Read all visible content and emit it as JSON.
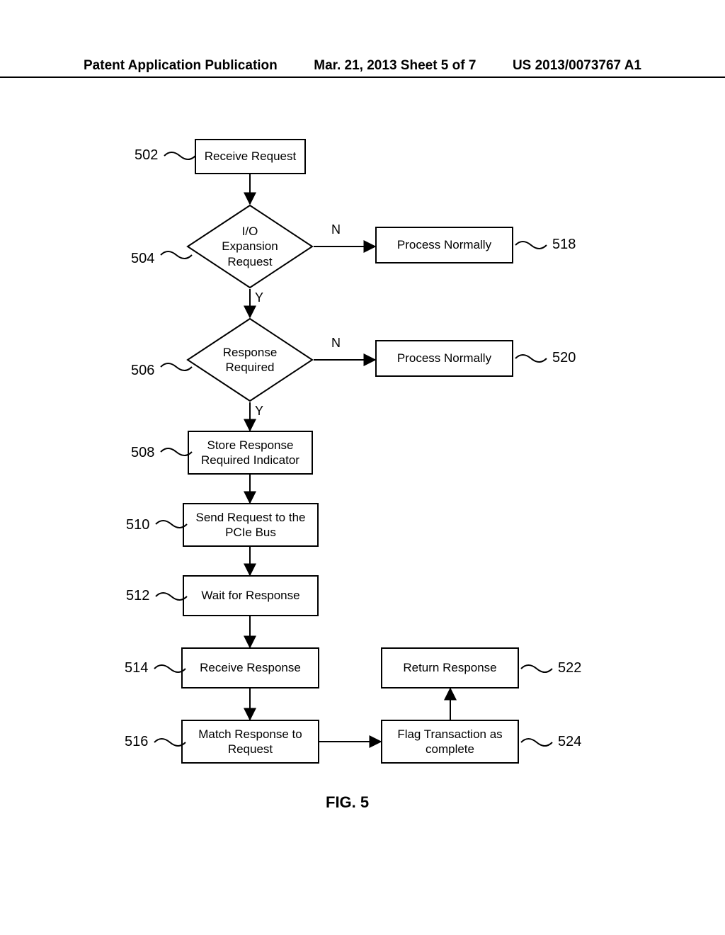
{
  "header": {
    "left": "Patent Application Publication",
    "mid": "Mar. 21, 2013  Sheet 5 of 7",
    "right": "US 2013/0073767 A1"
  },
  "nodes": {
    "n502": "Receive Request",
    "n504": "I/O\nExpansion\nRequest",
    "n506": "Response\nRequired",
    "n508": "Store Response\nRequired Indicator",
    "n510": "Send Request to the\nPCIe Bus",
    "n512": "Wait for Response",
    "n514": "Receive Response",
    "n516": "Match Response to\nRequest",
    "n518": "Process Normally",
    "n520": "Process Normally",
    "n522": "Return Response",
    "n524": "Flag Transaction as\ncomplete"
  },
  "refs": {
    "r502": "502",
    "r504": "504",
    "r506": "506",
    "r508": "508",
    "r510": "510",
    "r512": "512",
    "r514": "514",
    "r516": "516",
    "r518": "518",
    "r520": "520",
    "r522": "522",
    "r524": "524"
  },
  "edges": {
    "n504_no": "N",
    "n504_yes": "Y",
    "n506_no": "N",
    "n506_yes": "Y"
  },
  "figure": "FIG. 5",
  "chart_data": {
    "type": "flowchart",
    "nodes": [
      {
        "id": "502",
        "shape": "process",
        "text": "Receive Request"
      },
      {
        "id": "504",
        "shape": "decision",
        "text": "I/O Expansion Request"
      },
      {
        "id": "506",
        "shape": "decision",
        "text": "Response Required"
      },
      {
        "id": "508",
        "shape": "process",
        "text": "Store Response Required Indicator"
      },
      {
        "id": "510",
        "shape": "process",
        "text": "Send Request to the PCIe Bus"
      },
      {
        "id": "512",
        "shape": "process",
        "text": "Wait for Response"
      },
      {
        "id": "514",
        "shape": "process",
        "text": "Receive Response"
      },
      {
        "id": "516",
        "shape": "process",
        "text": "Match Response to Request"
      },
      {
        "id": "518",
        "shape": "process",
        "text": "Process Normally"
      },
      {
        "id": "520",
        "shape": "process",
        "text": "Process Normally"
      },
      {
        "id": "522",
        "shape": "process",
        "text": "Return Response"
      },
      {
        "id": "524",
        "shape": "process",
        "text": "Flag Transaction as complete"
      }
    ],
    "edges": [
      {
        "from": "502",
        "to": "504",
        "label": ""
      },
      {
        "from": "504",
        "to": "518",
        "label": "N"
      },
      {
        "from": "504",
        "to": "506",
        "label": "Y"
      },
      {
        "from": "506",
        "to": "520",
        "label": "N"
      },
      {
        "from": "506",
        "to": "508",
        "label": "Y"
      },
      {
        "from": "508",
        "to": "510",
        "label": ""
      },
      {
        "from": "510",
        "to": "512",
        "label": ""
      },
      {
        "from": "512",
        "to": "514",
        "label": ""
      },
      {
        "from": "514",
        "to": "516",
        "label": ""
      },
      {
        "from": "516",
        "to": "524",
        "label": ""
      },
      {
        "from": "524",
        "to": "522",
        "label": ""
      }
    ],
    "title": "FIG. 5"
  }
}
